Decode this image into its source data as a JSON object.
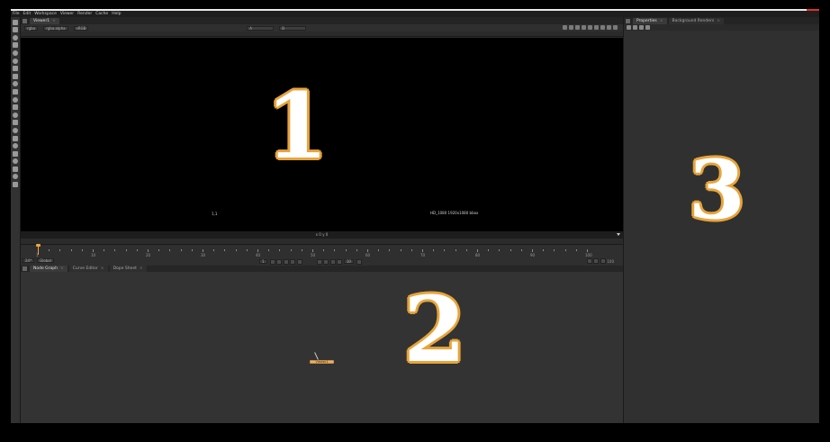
{
  "menubar": {
    "items": [
      "File",
      "Edit",
      "Workspace",
      "Viewer",
      "Render",
      "Cache",
      "Help"
    ]
  },
  "viewer": {
    "tab_label": "Viewer1",
    "controls": {
      "channel": "rgba",
      "layer": "rgba.alpha",
      "colorspace": "sRGB",
      "input_a": "A",
      "input_b": "B"
    },
    "viewport_label_left": "1,1",
    "viewport_label_right": "HD_1080 1920x1080 bbox",
    "status": "x 0 y 0"
  },
  "timeline": {
    "ticks": [
      "1",
      "10",
      "20",
      "30",
      "40",
      "50",
      "60",
      "70",
      "80",
      "90",
      "100"
    ],
    "frame_value": "1",
    "fps": "24*",
    "range": "Global",
    "frame_end": "100",
    "step": "10"
  },
  "node_graph": {
    "tabs": [
      "Node Graph",
      "Curve Editor",
      "Dope Sheet"
    ],
    "node_label": "Viewer1"
  },
  "properties": {
    "tabs": [
      "Properties",
      "Background Renders"
    ]
  },
  "annotations": {
    "one": "1",
    "two": "2",
    "three": "3"
  },
  "colors": {
    "accent_orange": "#e8a43a",
    "viewport": "#000000",
    "panel": "#2b2b2b"
  }
}
